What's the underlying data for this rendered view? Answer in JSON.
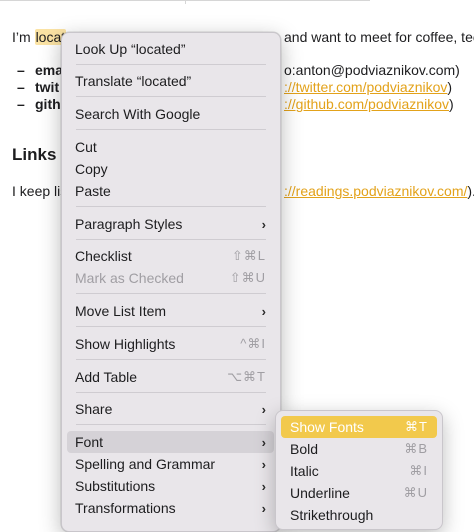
{
  "document": {
    "intro_prefix": "I’m ",
    "intro_highlight": "locat",
    "intro_suffix": "and want to meet for coffee, tee",
    "contacts": [
      {
        "label": "ema",
        "value": "o:anton@podviaznikov.com)"
      },
      {
        "label": "twit",
        "value": "://twitter.com/podviaznikov"
      },
      {
        "label": "gith",
        "value": "://github.com/podviaznikov"
      }
    ],
    "paren_close": ")",
    "heading": "Links",
    "links_prefix": "I keep lis",
    "links_link": "://readings.podviaznikov.com/",
    "links_suffix": ")."
  },
  "menu": {
    "look_up": "Look Up “located”",
    "translate": "Translate “located”",
    "search_google": "Search With Google",
    "cut": "Cut",
    "copy": "Copy",
    "paste": "Paste",
    "paragraph_styles": "Paragraph Styles",
    "checklist": "Checklist",
    "checklist_shortcut": "⇧⌘L",
    "mark_as_checked": "Mark as Checked",
    "mark_as_checked_shortcut": "⇧⌘U",
    "move_list_item": "Move List Item",
    "show_highlights": "Show Highlights",
    "show_highlights_shortcut": "^⌘I",
    "add_table": "Add Table",
    "add_table_shortcut": "⌥⌘T",
    "share": "Share",
    "font": "Font",
    "spelling_grammar": "Spelling and Grammar",
    "substitutions": "Substitutions",
    "transformations": "Transformations",
    "submenu_arrow": "›"
  },
  "font_submenu": {
    "show_fonts": "Show Fonts",
    "show_fonts_shortcut": "⌘T",
    "bold": "Bold",
    "bold_shortcut": "⌘B",
    "italic": "Italic",
    "italic_shortcut": "⌘I",
    "underline": "Underline",
    "underline_shortcut": "⌘U",
    "strikethrough": "Strikethrough"
  },
  "colors": {
    "highlight": "#fbe3a4",
    "link": "#e3a21a",
    "selection": "#f2c94c",
    "menu_bg": "#e9e6ea"
  }
}
